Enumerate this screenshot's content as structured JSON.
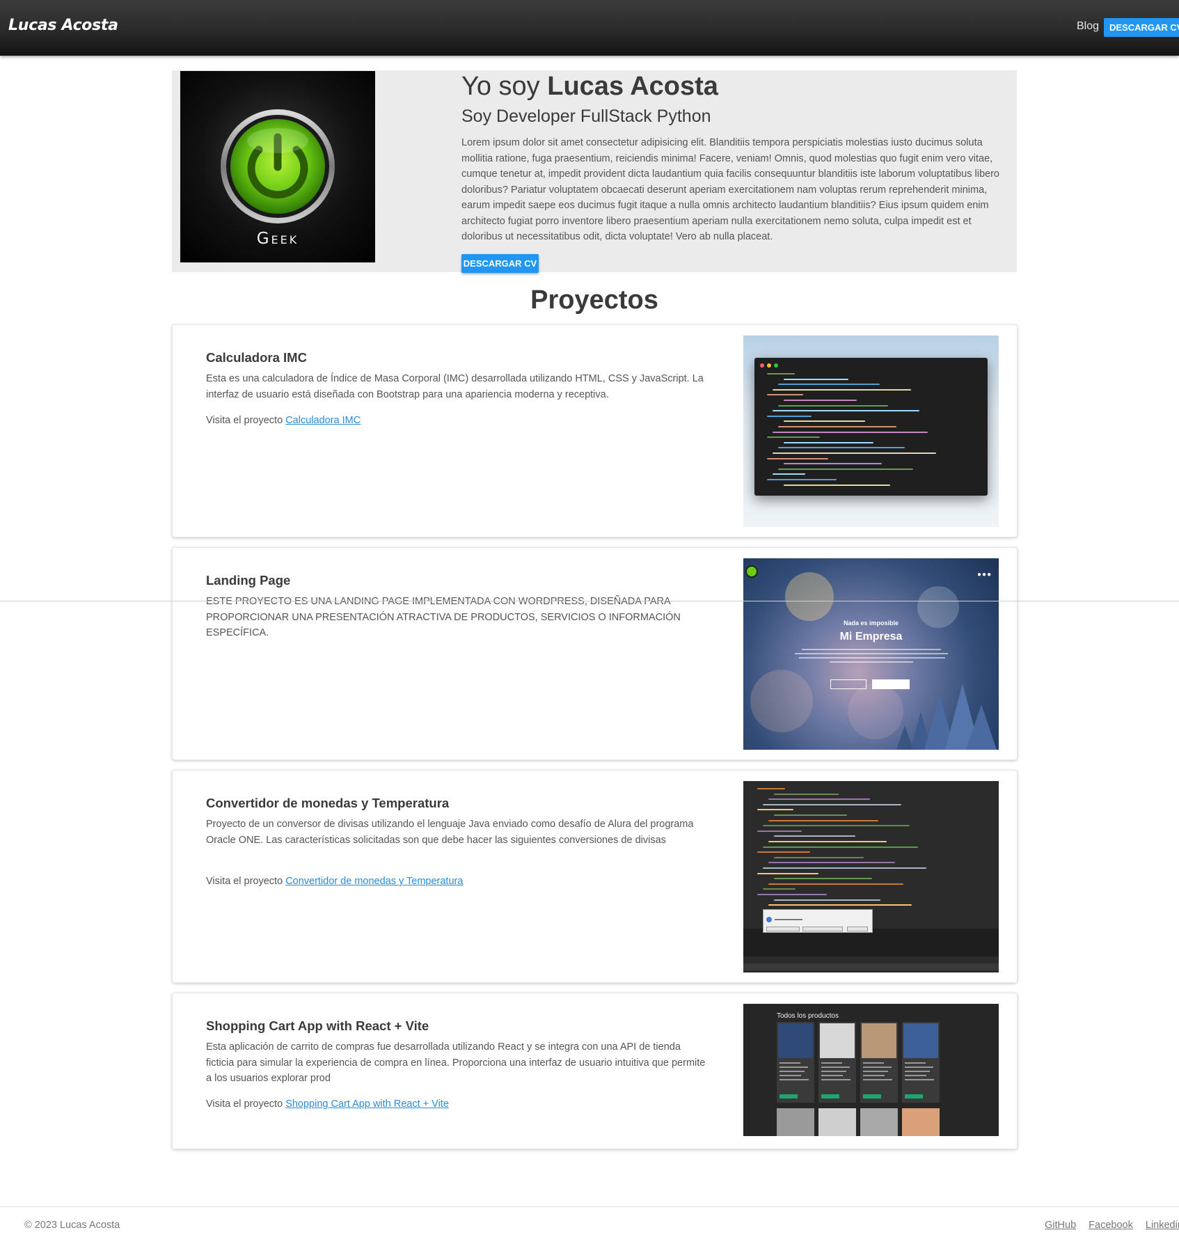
{
  "navbar": {
    "brand": "Lucas Acosta",
    "blog": "Blog",
    "cv_button": "DESCARGAR CV"
  },
  "hero": {
    "title_prefix": "Yo soy ",
    "title_name": "Lucas Acosta",
    "subtitle": "Soy Developer FullStack Python",
    "text": "Lorem ipsum dolor sit amet consectetur adipisicing elit. Blanditiis tempora perspiciatis molestias iusto ducimus soluta mollitia ratione, fuga praesentium, reiciendis minima! Facere, veniam! Omnis, quod molestias quo fugit enim vero vitae, cumque tenetur at, impedit provident dicta laudantium quia facilis consequuntur blanditiis iste laborum voluptatibus libero doloribus? Pariatur voluptatem obcaecati deserunt aperiam exercitationem nam voluptas rerum reprehenderit minima, earum impedit saepe eos ducimus fugit itaque a nulla omnis architecto laudantium blanditiis? Eius ipsum quidem enim architecto fugiat porro inventore libero praesentium aperiam nulla exercitationem nemo soluta, culpa impedit est et doloribus ut necessitatibus odit, dicta voluptate! Vero ab nulla placeat.",
    "button": "DESCARGAR CV",
    "image_label": "Geek"
  },
  "projects_title": "Proyectos",
  "projects": [
    {
      "title": "Calculadora IMC",
      "description": "Esta es una calculadora de Índice de Masa Corporal (IMC) desarrollada utilizando HTML, CSS y JavaScript. La interfaz de usuario está diseñada con Bootstrap para una apariencia moderna y receptiva.",
      "visit_prefix": "Visita el proyecto ",
      "link": "Calculadora IMC"
    },
    {
      "title": "Landing Page",
      "description": "ESTE PROYECTO ES UNA LANDING PAGE IMPLEMENTADA CON WORDPRESS, DISEÑADA PARA PROPORCIONAR UNA PRESENTACIÓN ATRACTIVA DE PRODUCTOS, SERVICIOS O INFORMACIÓN ESPECÍFICA.",
      "image_heading": "Nada es imposible",
      "image_title": "Mi Empresa"
    },
    {
      "title": "Convertidor de monedas y Temperatura",
      "description": "Proyecto de un conversor de divisas utilizando el lenguaje Java enviado como desafío de Alura del programa Oracle ONE. Las características solicitadas son que debe hacer las siguientes conversiones de divisas",
      "visit_prefix": "Visita el proyecto ",
      "link": "Convertidor de monedas y Temperatura"
    },
    {
      "title": "Shopping Cart App with React + Vite",
      "description": "Esta aplicación de carrito de compras fue desarrollada utilizando React y se integra con una API de tienda ficticia para simular la experiencia de compra en línea. Proporciona una interfaz de usuario intuitiva que permite a los usuarios explorar prod",
      "visit_prefix": "Visita el proyecto ",
      "link": "Shopping Cart App with React + Vite",
      "image_heading": "Todos los productos"
    }
  ],
  "footer": {
    "copyright": "© 2023 Lucas Acosta",
    "links": [
      "GitHub",
      "Facebook",
      "Linkedin"
    ]
  }
}
